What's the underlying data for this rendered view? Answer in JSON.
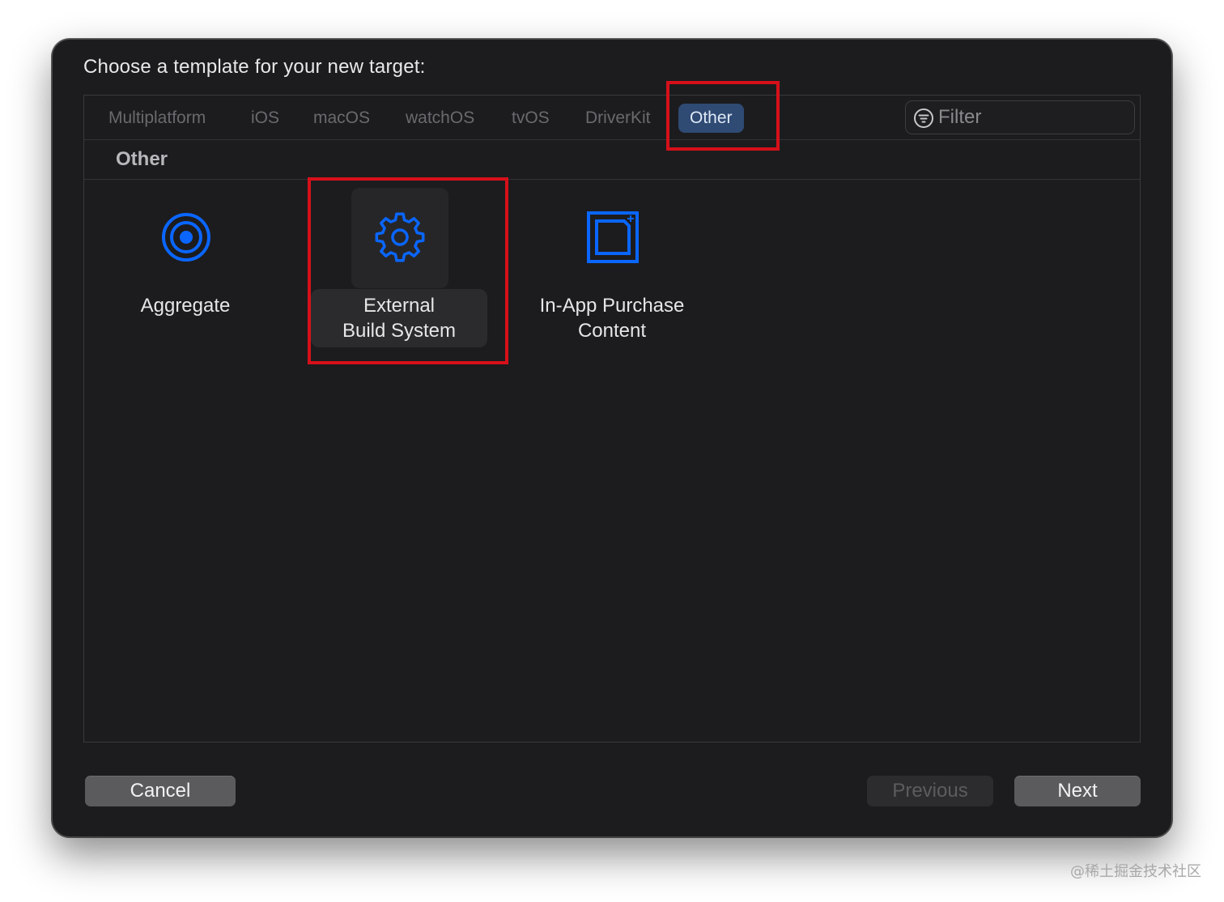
{
  "dialog": {
    "title": "Choose a template for your new target:"
  },
  "tabs": [
    {
      "label": "Multiplatform"
    },
    {
      "label": "iOS"
    },
    {
      "label": "macOS"
    },
    {
      "label": "watchOS"
    },
    {
      "label": "tvOS"
    },
    {
      "label": "DriverKit"
    },
    {
      "label": "Other",
      "selected": true
    }
  ],
  "filter": {
    "placeholder": "Filter",
    "icon": "filter-icon"
  },
  "section": {
    "title": "Other"
  },
  "templates": [
    {
      "label": "Aggregate",
      "icon": "target-icon"
    },
    {
      "label": "External\nBuild System",
      "icon": "gear-icon",
      "selected": true
    },
    {
      "label": "In-App Purchase\nContent",
      "icon": "in-app-purchase-icon"
    }
  ],
  "buttons": {
    "cancel": "Cancel",
    "previous": "Previous",
    "next": "Next"
  },
  "watermark": "@稀土掘金技术社区",
  "colors": {
    "accent": "#0a66ff",
    "highlight": "#d6101a",
    "window_bg": "#1c1c1e",
    "selected_tab_bg": "#2f4a73"
  }
}
